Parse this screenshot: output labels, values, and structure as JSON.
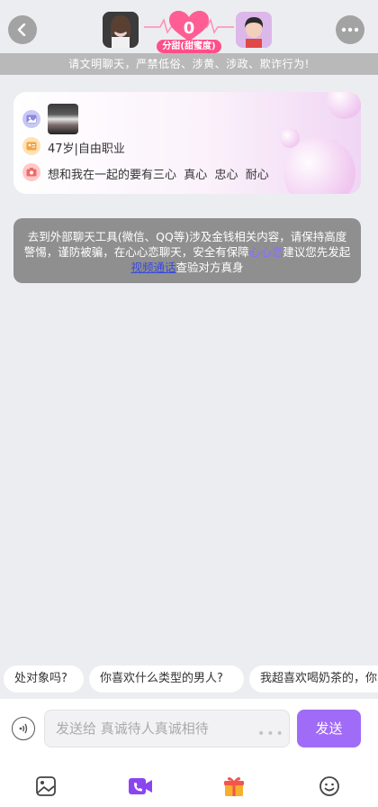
{
  "header": {
    "heart_count": "0",
    "heart_label": "分甜(甜蜜度)"
  },
  "warning": "请文明聊天，严禁低俗、涉黄、涉政、欺诈行为!",
  "profile": {
    "age_job": "47岁|自由职业",
    "motto": "想和我在一起的要有三心  真心  忠心  耐心"
  },
  "notice": {
    "part1": "去到外部聊天工具(微信、QQ等)涉及金钱相关内容，请保持高度警惕，谨防被骗，在心心恋聊天，安全有保障",
    "highlight": "心心恋",
    "part2": "建议您先发起",
    "link": "视频通话",
    "part3": "查验对方真身"
  },
  "quick_replies": [
    "处对象吗?",
    "你喜欢什么类型的男人?",
    "我超喜欢喝奶茶的，你"
  ],
  "input": {
    "placeholder": "发送给 真诚待人真诚相待",
    "send_label": "发送"
  },
  "colors": {
    "accent": "#a06bf6",
    "heart": "#ff4f8a"
  },
  "icons": [
    "back-arrow-icon",
    "more-icon",
    "heart-icon",
    "photo-icon",
    "id-card-icon",
    "camera-icon",
    "voice-icon",
    "image-icon",
    "video-call-icon",
    "gift-icon",
    "emoji-icon"
  ]
}
